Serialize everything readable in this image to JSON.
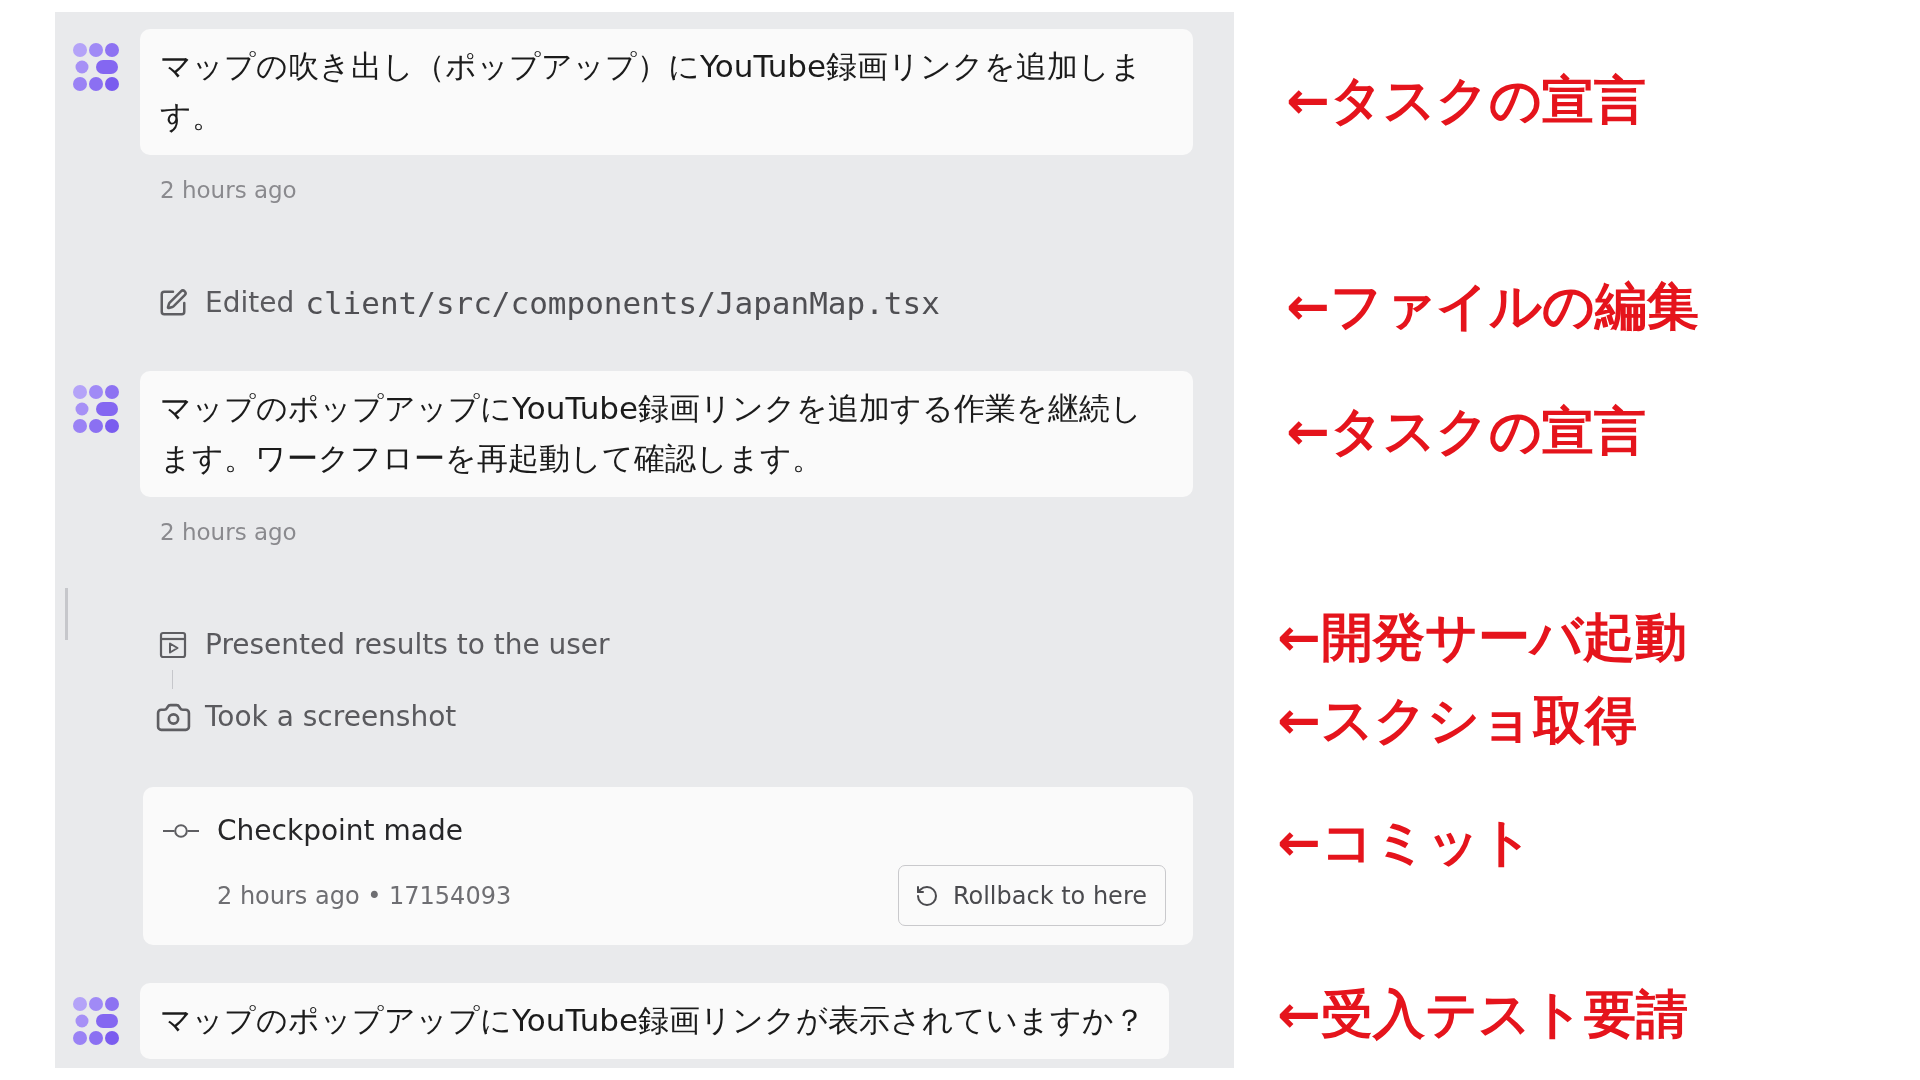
{
  "chat": {
    "items": [
      {
        "kind": "message",
        "text": "マップの吹き出し（ポップアップ）にYouTube録画リンクを追加します。",
        "time": "2 hours ago"
      },
      {
        "kind": "edit",
        "label": "Edited",
        "path": "client/src/components/JapanMap.tsx"
      },
      {
        "kind": "message",
        "text": "マップのポップアップにYouTube録画リンクを追加する作業を継続します。ワークフローを再起動して確認します。",
        "time": "2 hours ago"
      },
      {
        "kind": "steps",
        "steps": [
          {
            "kind": "present",
            "label": "Presented results to the user"
          },
          {
            "kind": "screenshot",
            "label": "Took a screenshot"
          }
        ]
      },
      {
        "kind": "checkpoint",
        "title": "Checkpoint made",
        "meta": "2 hours ago • 17154093",
        "button": "Rollback to here"
      },
      {
        "kind": "message",
        "text": "マップのポップアップにYouTube録画リンクが表示されていますか？"
      }
    ]
  },
  "annotations": [
    "←タスクの宣言",
    "←ファイルの編集",
    "←タスクの宣言",
    "←開発サーバ起動",
    "←スクショ取得",
    "←コミット",
    "←受入テスト要請"
  ]
}
